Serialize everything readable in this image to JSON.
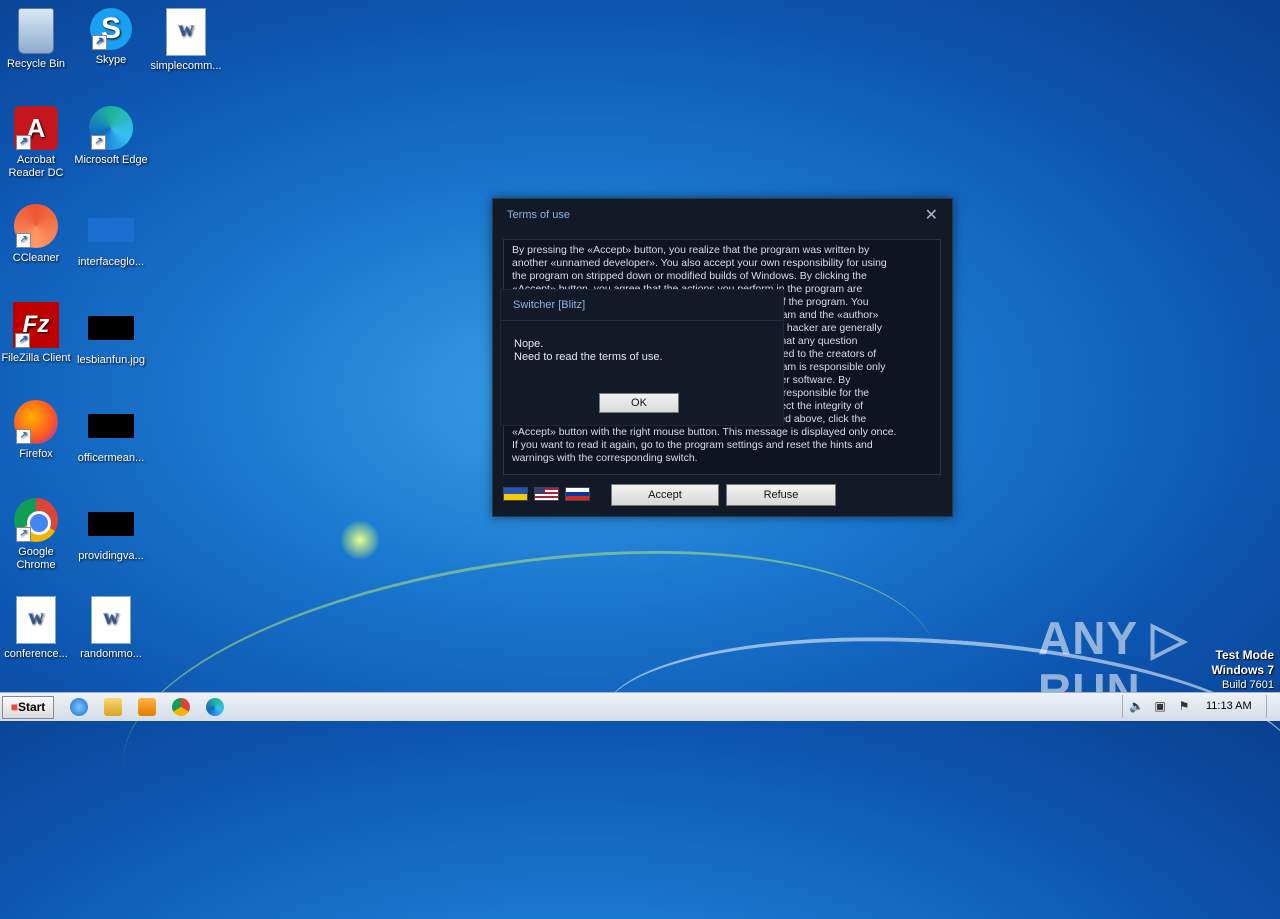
{
  "desktop": {
    "icons": [
      {
        "label": "Recycle Bin"
      },
      {
        "label": "Skype"
      },
      {
        "label": "simplecomm..."
      },
      {
        "label": "Acrobat Reader DC"
      },
      {
        "label": "Microsoft Edge"
      },
      {
        "label": "CCleaner"
      },
      {
        "label": "interfaceglo..."
      },
      {
        "label": "FileZilla Client"
      },
      {
        "label": "lesbianfun.jpg"
      },
      {
        "label": "Firefox"
      },
      {
        "label": "officermean..."
      },
      {
        "label": "Google Chrome"
      },
      {
        "label": "providingva..."
      },
      {
        "label": "conference..."
      },
      {
        "label": "randommo..."
      }
    ]
  },
  "dialog": {
    "title": "Terms of use",
    "close_glyph": "✕",
    "terms": "By pressing the «Accept» button, you realize that the program was written by\nanother «unnamed developer». You also accept your own responsibility for using\nthe program on stripped down or modified builds of Windows. By clicking the\n«Accept» button, you agree that the actions you perform in the program are\n                                                                                    ose of the program. You\n                                                                                    orogram and the «author»\n                                                                                    or the hacker are generally\n                                                                                    and that any question\n                                                                                    directed to the creators of\n                                                                                    orogram is responsible only\n                                                                                    n other software. By\n                                                                                    s not responsible for the\n                                                                                    at affect the integrity of\n                                                                                    scribed above, click the\n«Accept» button with the right mouse button. This message is displayed only once.\nIf you want to read it again, go to the program settings and reset the hints and\nwarnings with the corresponding switch.",
    "accept_label": "Accept",
    "refuse_label": "Refuse"
  },
  "subdialog": {
    "title": "Switcher [Blitz]",
    "message_line1": "Nope.",
    "message_line2": "Need to read the terms of use.",
    "ok_label": "OK"
  },
  "watermark": {
    "brand": "ANY ▷ RUN",
    "test_mode": "Test Mode",
    "os": "Windows 7",
    "build": "Build 7601"
  },
  "taskbar": {
    "start_label": "Start",
    "clock": "11:13 AM"
  }
}
